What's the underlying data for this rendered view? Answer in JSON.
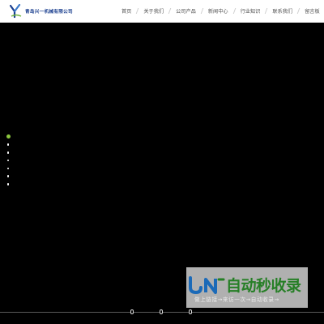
{
  "header": {
    "logo_mark": "Y",
    "company_name": "青岛兴一机械有限公司"
  },
  "nav": {
    "items": [
      {
        "label": "首页"
      },
      {
        "label": "关于我们"
      },
      {
        "label": "公司产品"
      },
      {
        "label": "新闻中心"
      },
      {
        "label": "行业知识"
      },
      {
        "label": "联系我们"
      },
      {
        "label": "留言板"
      }
    ]
  },
  "slider": {
    "active_index": 0,
    "dot_count": 7,
    "active_color": "#8cc63f"
  },
  "watermark": {
    "title": "自动秒收录",
    "subtitle": "做上链接→来访一次→自动收录→"
  },
  "colors": {
    "header_bg": "#ffffff",
    "hero_bg": "#000000",
    "accent": "#8cc63f",
    "logo_blue": "#1b3f8f"
  }
}
